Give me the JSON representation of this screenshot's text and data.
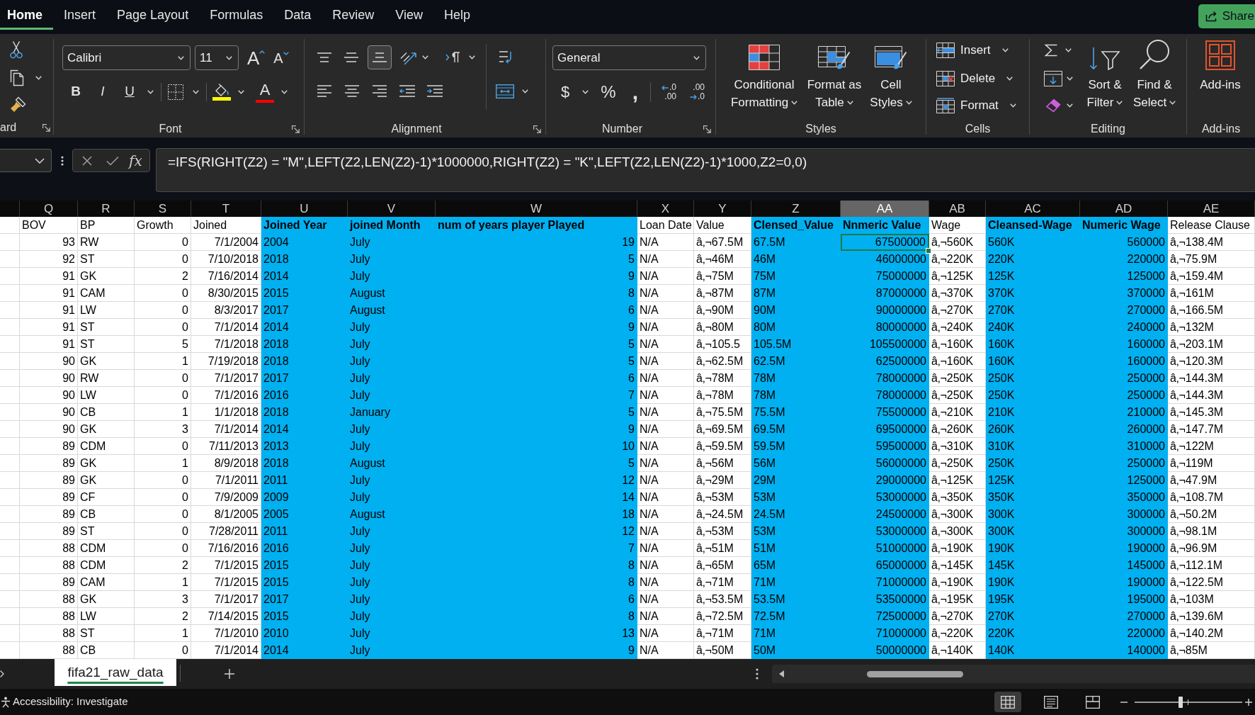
{
  "menu_tabs": [
    {
      "label": "Home",
      "selected": true
    },
    {
      "label": "Insert",
      "selected": false
    },
    {
      "label": "Page Layout",
      "selected": false
    },
    {
      "label": "Formulas",
      "selected": false
    },
    {
      "label": "Data",
      "selected": false
    },
    {
      "label": "Review",
      "selected": false
    },
    {
      "label": "View",
      "selected": false
    },
    {
      "label": "Help",
      "selected": false
    }
  ],
  "share_button": {
    "label": "Share"
  },
  "ribbon": {
    "clipboard": {
      "label": "ard"
    },
    "font": {
      "label": "Font",
      "font_name": "Calibri",
      "font_size": "11",
      "grow_button": "A",
      "shrink_button": "A",
      "bold_button": "B",
      "italic_button": "I",
      "underline_button": "U",
      "font_color_button": "A"
    },
    "alignment": {
      "label": "Alignment",
      "vertical_align": [
        {
          "selected": false
        },
        {
          "selected": false
        },
        {
          "selected": true
        }
      ]
    },
    "number": {
      "label": "Number",
      "format": "General",
      "currency_button": "$",
      "percent_button": "%",
      "comma_button": ",",
      "decimal_buttons": [
        {
          "lines": [
            ".0",
            ".00"
          ]
        },
        {
          "lines": [
            ".00",
            ".0"
          ]
        }
      ]
    },
    "styles": {
      "label": "Styles",
      "buttons": [
        {
          "lines": [
            "Conditional",
            "Formatting"
          ]
        },
        {
          "lines": [
            "Format as",
            "Table"
          ]
        },
        {
          "lines": [
            "Cell",
            "Styles"
          ]
        }
      ]
    },
    "cells": {
      "label": "Cells",
      "buttons": [
        "Insert",
        "Delete",
        "Format"
      ]
    },
    "editing": {
      "label": "Editing",
      "buttons": [
        {
          "lines": [
            "Sort &",
            "Filter"
          ]
        },
        {
          "lines": [
            "Find &",
            "Select"
          ]
        }
      ]
    },
    "add_ins": {
      "label": "Add-ins",
      "button": "Add-ins"
    }
  },
  "formula_bar": {
    "function_button": "fx",
    "formula": "=IFS(RIGHT(Z2) = \"M\",LEFT(Z2,LEN(Z2)-1)*1000000,RIGHT(Z2) = \"K\",LEFT(Z2,LEN(Z2)-1)*1000,Z2=0,0)"
  },
  "sheet": {
    "columns": [
      {
        "letter": "Q",
        "header": "BOV",
        "kind": "number",
        "highlighted": false,
        "selected": false
      },
      {
        "letter": "R",
        "header": "BP",
        "kind": "text",
        "highlighted": false,
        "selected": false
      },
      {
        "letter": "S",
        "header": "Growth",
        "kind": "number",
        "highlighted": false,
        "selected": false
      },
      {
        "letter": "T",
        "header": "Joined",
        "kind": "number",
        "highlighted": false,
        "selected": false
      },
      {
        "letter": "U",
        "header": "Joined Year",
        "kind": "text",
        "highlighted": true,
        "selected": false
      },
      {
        "letter": "V",
        "header": "joined Month",
        "kind": "text",
        "highlighted": true,
        "selected": false
      },
      {
        "letter": "W",
        "header": "num of years player Played",
        "kind": "number",
        "highlighted": true,
        "selected": false
      },
      {
        "letter": "X",
        "header": "Loan Date",
        "kind": "text",
        "highlighted": false,
        "selected": false
      },
      {
        "letter": "Y",
        "header": "Value",
        "kind": "text",
        "highlighted": false,
        "selected": false
      },
      {
        "letter": "Z",
        "header": "Clensed_Value",
        "kind": "text",
        "highlighted": true,
        "selected": false
      },
      {
        "letter": "AA",
        "header": "Nnmeric Value",
        "kind": "number",
        "highlighted": true,
        "selected": true
      },
      {
        "letter": "AB",
        "header": "Wage",
        "kind": "text",
        "highlighted": false,
        "selected": false
      },
      {
        "letter": "AC",
        "header": "Cleansed-Wage",
        "kind": "text",
        "highlighted": true,
        "selected": false
      },
      {
        "letter": "AD",
        "header": "Numeric Wage",
        "kind": "number",
        "highlighted": true,
        "selected": false
      },
      {
        "letter": "AE",
        "header": "Release Clause",
        "kind": "text",
        "highlighted": false,
        "selected": false
      }
    ],
    "rows": [
      {
        "selected": true,
        "cells": [
          "93",
          "RW",
          "0",
          "7/1/2004",
          "2004",
          "July",
          "19",
          "N/A",
          "â‚¬67.5M",
          "67.5M",
          "67500000",
          "â‚¬560K",
          "560K",
          "560000",
          "â‚¬138.4M"
        ]
      },
      {
        "selected": false,
        "cells": [
          "92",
          "ST",
          "0",
          "7/10/2018",
          "2018",
          "July",
          "5",
          "N/A",
          "â‚¬46M",
          "46M",
          "46000000",
          "â‚¬220K",
          "220K",
          "220000",
          "â‚¬75.9M"
        ]
      },
      {
        "selected": false,
        "cells": [
          "91",
          "GK",
          "2",
          "7/16/2014",
          "2014",
          "July",
          "9",
          "N/A",
          "â‚¬75M",
          "75M",
          "75000000",
          "â‚¬125K",
          "125K",
          "125000",
          "â‚¬159.4M"
        ]
      },
      {
        "selected": false,
        "cells": [
          "91",
          "CAM",
          "0",
          "8/30/2015",
          "2015",
          "August",
          "8",
          "N/A",
          "â‚¬87M",
          "87M",
          "87000000",
          "â‚¬370K",
          "370K",
          "370000",
          "â‚¬161M"
        ]
      },
      {
        "selected": false,
        "cells": [
          "91",
          "LW",
          "0",
          "8/3/2017",
          "2017",
          "August",
          "6",
          "N/A",
          "â‚¬90M",
          "90M",
          "90000000",
          "â‚¬270K",
          "270K",
          "270000",
          "â‚¬166.5M"
        ]
      },
      {
        "selected": false,
        "cells": [
          "91",
          "ST",
          "0",
          "7/1/2014",
          "2014",
          "July",
          "9",
          "N/A",
          "â‚¬80M",
          "80M",
          "80000000",
          "â‚¬240K",
          "240K",
          "240000",
          "â‚¬132M"
        ]
      },
      {
        "selected": false,
        "cells": [
          "91",
          "ST",
          "5",
          "7/1/2018",
          "2018",
          "July",
          "5",
          "N/A",
          "â‚¬105.5",
          "105.5M",
          "105500000",
          "â‚¬160K",
          "160K",
          "160000",
          "â‚¬203.1M"
        ]
      },
      {
        "selected": false,
        "cells": [
          "90",
          "GK",
          "1",
          "7/19/2018",
          "2018",
          "July",
          "5",
          "N/A",
          "â‚¬62.5M",
          "62.5M",
          "62500000",
          "â‚¬160K",
          "160K",
          "160000",
          "â‚¬120.3M"
        ]
      },
      {
        "selected": false,
        "cells": [
          "90",
          "RW",
          "0",
          "7/1/2017",
          "2017",
          "July",
          "6",
          "N/A",
          "â‚¬78M",
          "78M",
          "78000000",
          "â‚¬250K",
          "250K",
          "250000",
          "â‚¬144.3M"
        ]
      },
      {
        "selected": false,
        "cells": [
          "90",
          "LW",
          "0",
          "7/1/2016",
          "2016",
          "July",
          "7",
          "N/A",
          "â‚¬78M",
          "78M",
          "78000000",
          "â‚¬250K",
          "250K",
          "250000",
          "â‚¬144.3M"
        ]
      },
      {
        "selected": false,
        "cells": [
          "90",
          "CB",
          "1",
          "1/1/2018",
          "2018",
          "January",
          "5",
          "N/A",
          "â‚¬75.5M",
          "75.5M",
          "75500000",
          "â‚¬210K",
          "210K",
          "210000",
          "â‚¬145.3M"
        ]
      },
      {
        "selected": false,
        "cells": [
          "90",
          "GK",
          "3",
          "7/1/2014",
          "2014",
          "July",
          "9",
          "N/A",
          "â‚¬69.5M",
          "69.5M",
          "69500000",
          "â‚¬260K",
          "260K",
          "260000",
          "â‚¬147.7M"
        ]
      },
      {
        "selected": false,
        "cells": [
          "89",
          "CDM",
          "0",
          "7/11/2013",
          "2013",
          "July",
          "10",
          "N/A",
          "â‚¬59.5M",
          "59.5M",
          "59500000",
          "â‚¬310K",
          "310K",
          "310000",
          "â‚¬122M"
        ]
      },
      {
        "selected": false,
        "cells": [
          "89",
          "GK",
          "1",
          "8/9/2018",
          "2018",
          "August",
          "5",
          "N/A",
          "â‚¬56M",
          "56M",
          "56000000",
          "â‚¬250K",
          "250K",
          "250000",
          "â‚¬119M"
        ]
      },
      {
        "selected": false,
        "cells": [
          "89",
          "GK",
          "0",
          "7/1/2011",
          "2011",
          "July",
          "12",
          "N/A",
          "â‚¬29M",
          "29M",
          "29000000",
          "â‚¬125K",
          "125K",
          "125000",
          "â‚¬47.9M"
        ]
      },
      {
        "selected": false,
        "cells": [
          "89",
          "CF",
          "0",
          "7/9/2009",
          "2009",
          "July",
          "14",
          "N/A",
          "â‚¬53M",
          "53M",
          "53000000",
          "â‚¬350K",
          "350K",
          "350000",
          "â‚¬108.7M"
        ]
      },
      {
        "selected": false,
        "cells": [
          "89",
          "CB",
          "0",
          "8/1/2005",
          "2005",
          "August",
          "18",
          "N/A",
          "â‚¬24.5M",
          "24.5M",
          "24500000",
          "â‚¬300K",
          "300K",
          "300000",
          "â‚¬50.2M"
        ]
      },
      {
        "selected": false,
        "cells": [
          "89",
          "ST",
          "0",
          "7/28/2011",
          "2011",
          "July",
          "12",
          "N/A",
          "â‚¬53M",
          "53M",
          "53000000",
          "â‚¬300K",
          "300K",
          "300000",
          "â‚¬98.1M"
        ]
      },
      {
        "selected": false,
        "cells": [
          "88",
          "CDM",
          "0",
          "7/16/2016",
          "2016",
          "July",
          "7",
          "N/A",
          "â‚¬51M",
          "51M",
          "51000000",
          "â‚¬190K",
          "190K",
          "190000",
          "â‚¬96.9M"
        ]
      },
      {
        "selected": false,
        "cells": [
          "88",
          "CDM",
          "2",
          "7/1/2015",
          "2015",
          "July",
          "8",
          "N/A",
          "â‚¬65M",
          "65M",
          "65000000",
          "â‚¬145K",
          "145K",
          "145000",
          "â‚¬112.1M"
        ]
      },
      {
        "selected": false,
        "cells": [
          "89",
          "CAM",
          "1",
          "7/1/2015",
          "2015",
          "July",
          "8",
          "N/A",
          "â‚¬71M",
          "71M",
          "71000000",
          "â‚¬190K",
          "190K",
          "190000",
          "â‚¬122.5M"
        ]
      },
      {
        "selected": false,
        "cells": [
          "88",
          "GK",
          "3",
          "7/1/2017",
          "2017",
          "July",
          "6",
          "N/A",
          "â‚¬53.5M",
          "53.5M",
          "53500000",
          "â‚¬195K",
          "195K",
          "195000",
          "â‚¬103M"
        ]
      },
      {
        "selected": false,
        "cells": [
          "88",
          "LW",
          "2",
          "7/14/2015",
          "2015",
          "July",
          "8",
          "N/A",
          "â‚¬72.5M",
          "72.5M",
          "72500000",
          "â‚¬270K",
          "270K",
          "270000",
          "â‚¬139.6M"
        ]
      },
      {
        "selected": false,
        "cells": [
          "88",
          "ST",
          "1",
          "7/1/2010",
          "2010",
          "July",
          "13",
          "N/A",
          "â‚¬71M",
          "71M",
          "71000000",
          "â‚¬220K",
          "220K",
          "220000",
          "â‚¬140.2M"
        ]
      },
      {
        "selected": false,
        "cells": [
          "88",
          "CB",
          "0",
          "7/1/2014",
          "2014",
          "July",
          "9",
          "N/A",
          "â‚¬50M",
          "50M",
          "50000000",
          "â‚¬140K",
          "140K",
          "140000",
          "â‚¬85M"
        ]
      }
    ]
  },
  "sheet_tabs": [
    {
      "label": "fifa21_raw_data",
      "selected": true
    }
  ],
  "status_bar": {
    "accessibility": "Accessibility: Investigate",
    "views": [
      {
        "selected": true
      },
      {
        "selected": false
      },
      {
        "selected": false
      }
    ],
    "zoom_slider": {
      "level": 0.43
    }
  }
}
